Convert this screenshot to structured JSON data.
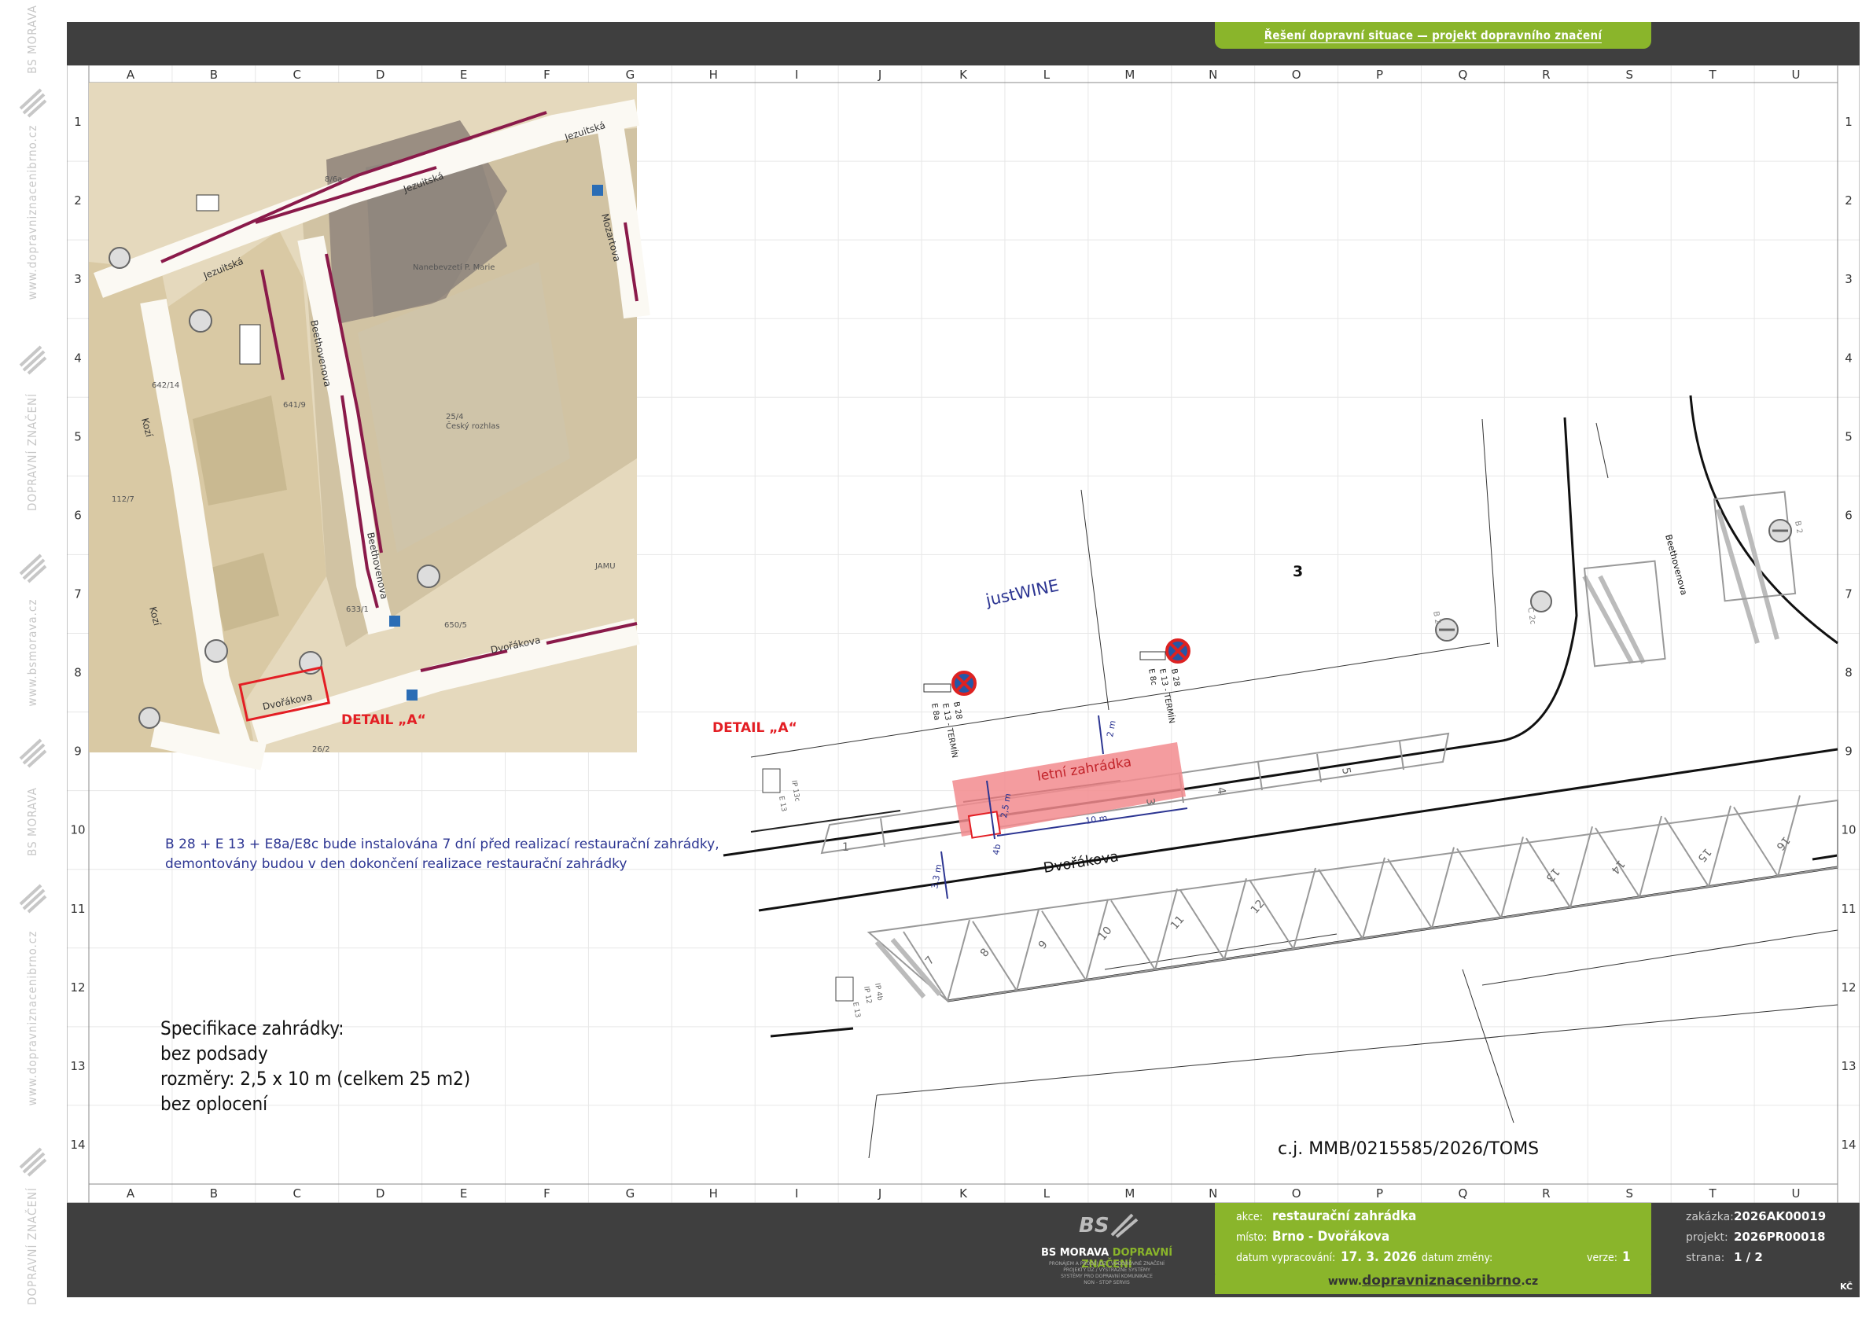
{
  "header": {
    "title": "Řešení dopravní situace — projekt dopravního značení"
  },
  "sidebar": {
    "items": [
      "BS MORAVA",
      "www.dopravniznacenibrno.cz",
      "DOPRAVNÍ ZNAČENÍ",
      "www.bsmorava.cz",
      "BS MORAVA",
      "www.dopravniznacenibrno.cz",
      "DOPRAVNÍ ZNAČENÍ"
    ]
  },
  "grid": {
    "columns": [
      "A",
      "B",
      "C",
      "D",
      "E",
      "F",
      "G",
      "H",
      "I",
      "J",
      "K",
      "L",
      "M",
      "N",
      "O",
      "P",
      "Q",
      "R",
      "S",
      "T",
      "U"
    ],
    "rows": [
      "1",
      "2",
      "3",
      "4",
      "5",
      "6",
      "7",
      "8",
      "9",
      "10",
      "11",
      "12",
      "13",
      "14"
    ]
  },
  "map": {
    "streets": {
      "jezuitska_a": "Jezuitská",
      "jezuitska_b": "Jezuitská",
      "jezuitska_c": "Jezuitská",
      "mozartova": "Mozartova",
      "beethovenova_a": "Beethovenova",
      "beethovenova_b": "Beethovenova",
      "kozi_a": "Kozí",
      "kozi_b": "Kozí",
      "dvorakova_a": "Dvořákova",
      "dvorakova_b": "Dvořákova"
    },
    "labels": {
      "church": "Nanebevzetí P. Marie",
      "cesky_rozhlas": "Český rozhlas",
      "rozhlas_no": "25/4",
      "jamu": "JAMU",
      "no_642": "642/14",
      "no_641": "641/9",
      "no_112": "112/7",
      "no_633": "633/1",
      "no_650": "650/5",
      "no_26": "26/2",
      "no_86": "8/6a"
    },
    "detail_label": "DETAIL „A“"
  },
  "drawing": {
    "detail_label": "DETAIL „A“",
    "justwine": "justWINE",
    "building_no": "3",
    "street": "Dvořákova",
    "street_beethovenova": "Beethovenova",
    "garden_label": "letní zahrádka",
    "dim_width": "2,5 m",
    "dim_length": "10 m",
    "dim_gap": "2 m",
    "dim_lane": "3,3 m",
    "sign_codes": {
      "s1": "B 28",
      "s2": "E 13 - TERMÍN",
      "s3": "E 8a",
      "s4": "B 28",
      "s5": "E 13 - TERMÍN",
      "s6": "E 8c",
      "ip13": "IP 13c",
      "e13": "E 13",
      "ip12": "IP 12",
      "ip4": "IP 4b",
      "e13b": "E 13",
      "b2a": "B 2",
      "b2b": "B 2",
      "c2": "C 2c"
    },
    "spaces_top": [
      "1",
      "2",
      "3",
      "4",
      "5"
    ],
    "spaces_bottom": [
      "7",
      "8",
      "9",
      "10",
      "11",
      "12",
      "13",
      "14",
      "15",
      "16"
    ],
    "sign_4b": "4b"
  },
  "notes": {
    "line1": "B 28 + E 13 + E8a/E8c bude instalována 7 dní před realizací restaurační zahrádky,",
    "line2": "demontovány budou v den dokončení realizace restaurační zahrádky"
  },
  "spec": {
    "title": "Specifikace zahrádky:",
    "line1": "bez podsady",
    "line2": "rozměry: 2,5 x 10 m (celkem 25 m2)",
    "line3": "bez oplocení"
  },
  "cj": "c.j. MMB/0215585/2026/TOMS",
  "titleblock": {
    "company": "BS MORAVA",
    "company_accent": "DOPRAVNÍ ZNAČENÍ",
    "company_sub1": "PRONÁJEM A PRODEJ DZ / VODOROVNÉ ZNAČENÍ",
    "company_sub2": "PROJEKTY DZ / VÝSTRAŽNÉ SYSTÉMY",
    "company_sub3": "SYSTÉMY PRO DOPRAVNÍ KOMUNIKACE",
    "company_sub4": "NON - STOP SERVIS",
    "akce_label": "akce:",
    "akce_value": "restaurační zahrádka",
    "misto_label": "místo:",
    "misto_value": "Brno - Dvořákova",
    "datum_label": "datum vypracování:",
    "datum_value": "17. 3. 2026",
    "zmeny_label": "datum změny:",
    "verze_label": "verze:",
    "verze_value": "1",
    "zakazka_label": "zakázka:",
    "zakazka_value": "2026AK00019",
    "projekt_label": "projekt:",
    "projekt_value": "2026PR00018",
    "strana_label": "strana:",
    "strana_value": "1 / 2",
    "www_prefix": "www.",
    "www_main": "dopravniznacenibrno",
    "www_suffix": ".cz",
    "initials": "KČ"
  },
  "colors": {
    "green": "#8ab52b",
    "dark": "#3f3f3f",
    "garden": "#f28b8e",
    "navy": "#2c3592",
    "red": "#e31e24"
  }
}
